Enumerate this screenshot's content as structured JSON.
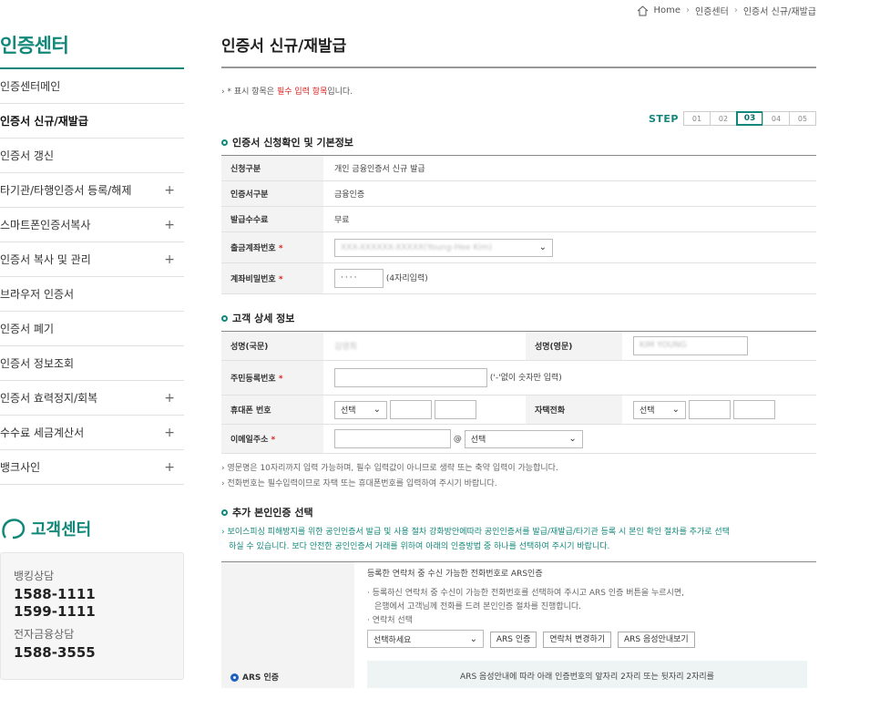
{
  "breadcrumb": {
    "home": "Home",
    "level1": "인증센터",
    "level2": "인증서 신규/재발급"
  },
  "sidebar": {
    "title": "인증센터",
    "items": [
      {
        "label": "인증센터메인",
        "plus": ""
      },
      {
        "label": "인증서 신규/재발급",
        "plus": ""
      },
      {
        "label": "인증서 갱신",
        "plus": ""
      },
      {
        "label": "타기관/타행인증서 등록/해제",
        "plus": "+"
      },
      {
        "label": "스마트폰인증서복사",
        "plus": "+"
      },
      {
        "label": "인증서 복사 및 관리",
        "plus": "+"
      },
      {
        "label": "브라우저 인증서",
        "plus": ""
      },
      {
        "label": "인증서 폐기",
        "plus": ""
      },
      {
        "label": "인증서 정보조회",
        "plus": ""
      },
      {
        "label": "인증서 효력정지/회복",
        "plus": "+"
      },
      {
        "label": "수수료 세금계산서",
        "plus": "+"
      },
      {
        "label": "뱅크사인",
        "plus": "+"
      }
    ],
    "active_index": 1
  },
  "customer_center": {
    "title": "고객센터",
    "banking_label": "뱅킹상담",
    "banking_num1": "1588-1111",
    "banking_num2": "1599-1111",
    "efin_label": "전자금융상담",
    "efin_num": "1588-3555"
  },
  "main": {
    "title": "인증서 신규/재발급",
    "notice_prefix": "* 표시 항목은 ",
    "notice_red": "필수 입력 항목",
    "notice_suffix": "입니다.",
    "step_label": "STEP",
    "steps": [
      "01",
      "02",
      "03",
      "04",
      "05"
    ],
    "current_step": "03"
  },
  "basic_info": {
    "title": "인증서 신청확인 및 기본정보",
    "row1_label": "신청구분",
    "row1_value": "개인 금융인증서 신규 발급",
    "row2_label": "인증서구분",
    "row2_value": "금융인증",
    "row3_label": "발급수수료",
    "row3_value": "무료",
    "row4_label": "출금계좌번호",
    "row4_value": "XXX-XXXXXX-XXXXX(Young-Hee Kim)",
    "row5_label": "계좌비밀번호",
    "row5_value": "····",
    "row5_hint": "(4자리입력)",
    "required_mark": "*"
  },
  "customer_info": {
    "title": "고객 상세 정보",
    "name_kr_label": "성명(국문)",
    "name_kr_value": "김영희",
    "name_en_label": "성명(영문)",
    "name_en_value": "KIM YOUNG",
    "rrn_label": "주민등록번호",
    "rrn_hint": "('-'없이 숫자만 입력)",
    "mobile_label": "휴대폰 번호",
    "mobile_select": "선택",
    "home_label": "자택전화",
    "home_select": "선택",
    "email_label": "이메일주소",
    "email_at": "@",
    "email_select": "선택",
    "required_mark": "*"
  },
  "notes": {
    "line1": "영문명은 10자리까지 입력 가능하며, 필수 입력값이 아니므로 생략 또는 축약 입력이 가능합니다.",
    "line2": "전화번호는 필수입력이므로 자택 또는 휴대폰번호를 입력하여 주시기 바랍니다."
  },
  "extra_auth": {
    "title": "추가 본인인증 선택",
    "green_line1": "보이스피싱 피해방지를 위한 공인인증서 발급 및 사용 절차 강화방안에따라 공인인증서를 발급/재발급/타기관 등록 시 본인 확인 절차를 추가로 선택",
    "green_line2": "하실 수 있습니다. 보다 안전한 공인인증서 거래를 위하여 아래의 인증방법 중 하나를 선택하여 주시기 바랍니다.",
    "ars_option": "ARS 인증",
    "ars_heading": "등록한 연락처 중 수신 가능한 전화번호로 ARS인증",
    "ars_desc1": "· 등록하신 연락처 중 수신이 가능한 전화번호를 선택하여 주시고 ARS 인증 버튼을 누르시면,",
    "ars_desc2": "은행에서 고객님께 전화를 드려 본인인증 절차를 진행합니다.",
    "ars_desc3": "· 연락처 선택",
    "contact_select": "선택하세요",
    "btn_ars": "ARS 인증",
    "btn_change": "연락처 변경하기",
    "btn_guide": "ARS 음성안내보기",
    "ars_box_text": "ARS 음성안내에 따라 아래 인증번호의 앞자리 2자리 또는 뒷자리 2자리를"
  }
}
